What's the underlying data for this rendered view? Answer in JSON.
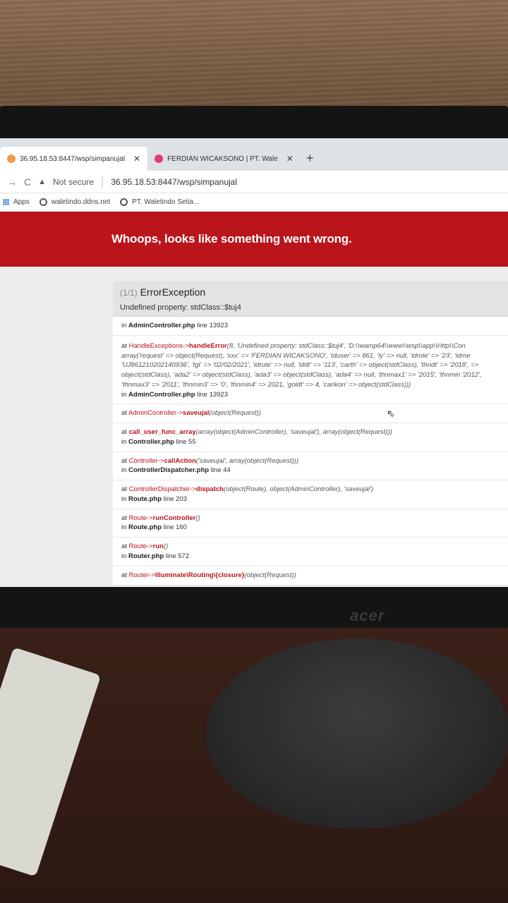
{
  "browser": {
    "tabs": [
      {
        "label": "36.95.18.53:8447/wsp/simpanujal",
        "active": true,
        "close": "✕"
      },
      {
        "label": "FERDIAN WICAKSONO | PT. Wale",
        "active": false,
        "close": "✕"
      }
    ],
    "new_tab": "+",
    "security_label": "Not secure",
    "url": "36.95.18.53:8447/wsp/simpanujal",
    "bookmarks": [
      {
        "label": "Apps",
        "icon": "apps-icon"
      },
      {
        "label": "waletindo.ddns.net",
        "icon": "globe-icon"
      },
      {
        "label": "PT. Waletindo Setia...",
        "icon": "globe-icon"
      }
    ]
  },
  "error": {
    "banner": "Whoops, looks like something went wrong.",
    "count": "(1/1)",
    "exception": "ErrorException",
    "message": "Undefined property: stdClass::$tuj4",
    "location_prefix": "in",
    "location_file": "AdminController.php",
    "location_line": "line 13923",
    "frames": [
      {
        "prefix": "at",
        "class": "HandleExceptions",
        "arrow": "->",
        "func": "handleError",
        "args": "(8, 'Undefined property: stdClass::$tuj4', 'D:\\\\wamp64\\\\www\\\\wsp\\\\app\\\\Http\\\\Con array('request' => object(Request), 'xxx' => 'FERDIAN WICAKSONO', 'iduser' => 861, 'ly' => null, 'idrole' => '23', 'idme 'UJ861210202140936', 'tgl' => '02/02/2021', 'idrute' => null, 'iddt' => '113', 'carth' => object(stdClass), 'thndt' => '2018', => object(stdClass), 'ada2' => object(stdClass), 'ada3' => object(stdClass), 'ada4' => null, 'thnmax1' => '2015', 'thnmin '2012', 'thnmax3' => '2011', 'thnmin3' => '0', 'thnmin4' => 2021, 'goldt' => 4, 'carikon' => object(stdClass)))",
        "file": "AdminController.php",
        "line": "line 13923"
      },
      {
        "prefix": "at",
        "class": "AdminController",
        "arrow": "->",
        "func": "saveujal",
        "args": "(object(Request))",
        "file": "",
        "line": ""
      },
      {
        "prefix": "at",
        "class": "",
        "arrow": "",
        "func": "call_user_func_array",
        "args": "(array(object(AdminController), 'saveujal'), array(object(Request)))",
        "file": "Controller.php",
        "line": "line 55"
      },
      {
        "prefix": "at",
        "class": "Controller",
        "arrow": "->",
        "func": "callAction",
        "args": "('saveujal', array(object(Request)))",
        "file": "ControllerDispatcher.php",
        "line": "line 44"
      },
      {
        "prefix": "at",
        "class": "ControllerDispatcher",
        "arrow": "->",
        "func": "dispatch",
        "args": "(object(Route), object(AdminController), 'saveujal')",
        "file": "Route.php",
        "line": "line 203"
      },
      {
        "prefix": "at",
        "class": "Route",
        "arrow": "->",
        "func": "runController",
        "args": "()",
        "file": "Route.php",
        "line": "line 160"
      },
      {
        "prefix": "at",
        "class": "Route",
        "arrow": "->",
        "func": "run",
        "args": "()",
        "file": "Router.php",
        "line": "line 572"
      },
      {
        "prefix": "at",
        "class": "Router",
        "arrow": "->",
        "func": "Illuminate\\Routing\\{closure}",
        "args": "(object(Request))",
        "file": "",
        "line": ""
      }
    ]
  },
  "monitor": {
    "brand": "acer"
  },
  "colors": {
    "banner": "#b9151b",
    "accent": "#b9151b",
    "taskbar": "#1b2631"
  }
}
